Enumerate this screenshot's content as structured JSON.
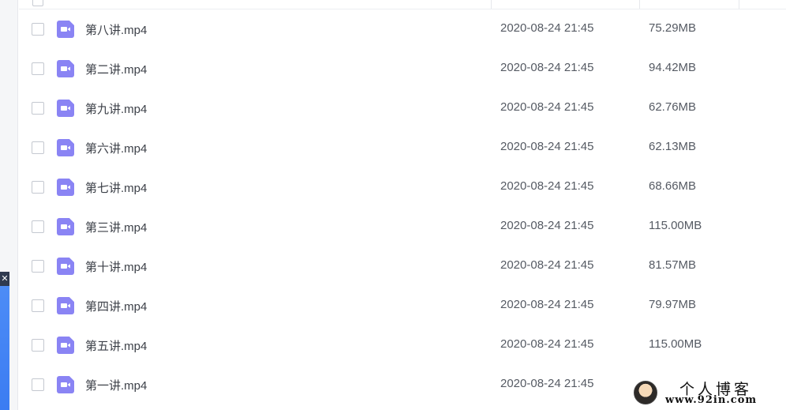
{
  "side_panel": {
    "close_glyph": "✕"
  },
  "files": [
    {
      "name": "第八讲.mp4",
      "date": "2020-08-24 21:45",
      "size": "75.29MB",
      "icon": "video-file-icon"
    },
    {
      "name": "第二讲.mp4",
      "date": "2020-08-24 21:45",
      "size": "94.42MB",
      "icon": "video-file-icon"
    },
    {
      "name": "第九讲.mp4",
      "date": "2020-08-24 21:45",
      "size": "62.76MB",
      "icon": "video-file-icon"
    },
    {
      "name": "第六讲.mp4",
      "date": "2020-08-24 21:45",
      "size": "62.13MB",
      "icon": "video-file-icon"
    },
    {
      "name": "第七讲.mp4",
      "date": "2020-08-24 21:45",
      "size": "68.66MB",
      "icon": "video-file-icon"
    },
    {
      "name": "第三讲.mp4",
      "date": "2020-08-24 21:45",
      "size": "115.00MB",
      "icon": "video-file-icon"
    },
    {
      "name": "第十讲.mp4",
      "date": "2020-08-24 21:45",
      "size": "81.57MB",
      "icon": "video-file-icon"
    },
    {
      "name": "第四讲.mp4",
      "date": "2020-08-24 21:45",
      "size": "79.97MB",
      "icon": "video-file-icon"
    },
    {
      "name": "第五讲.mp4",
      "date": "2020-08-24 21:45",
      "size": "115.00MB",
      "icon": "video-file-icon"
    },
    {
      "name": "第一讲.mp4",
      "date": "2020-08-24 21:45",
      "size": "",
      "icon": "video-file-icon"
    }
  ],
  "watermark": {
    "title": "个人博客",
    "url": "www.92in.com"
  },
  "colors": {
    "file_icon": "#8a84f4",
    "side_tab": "#3b7cf2",
    "text": "#3b3f47"
  }
}
